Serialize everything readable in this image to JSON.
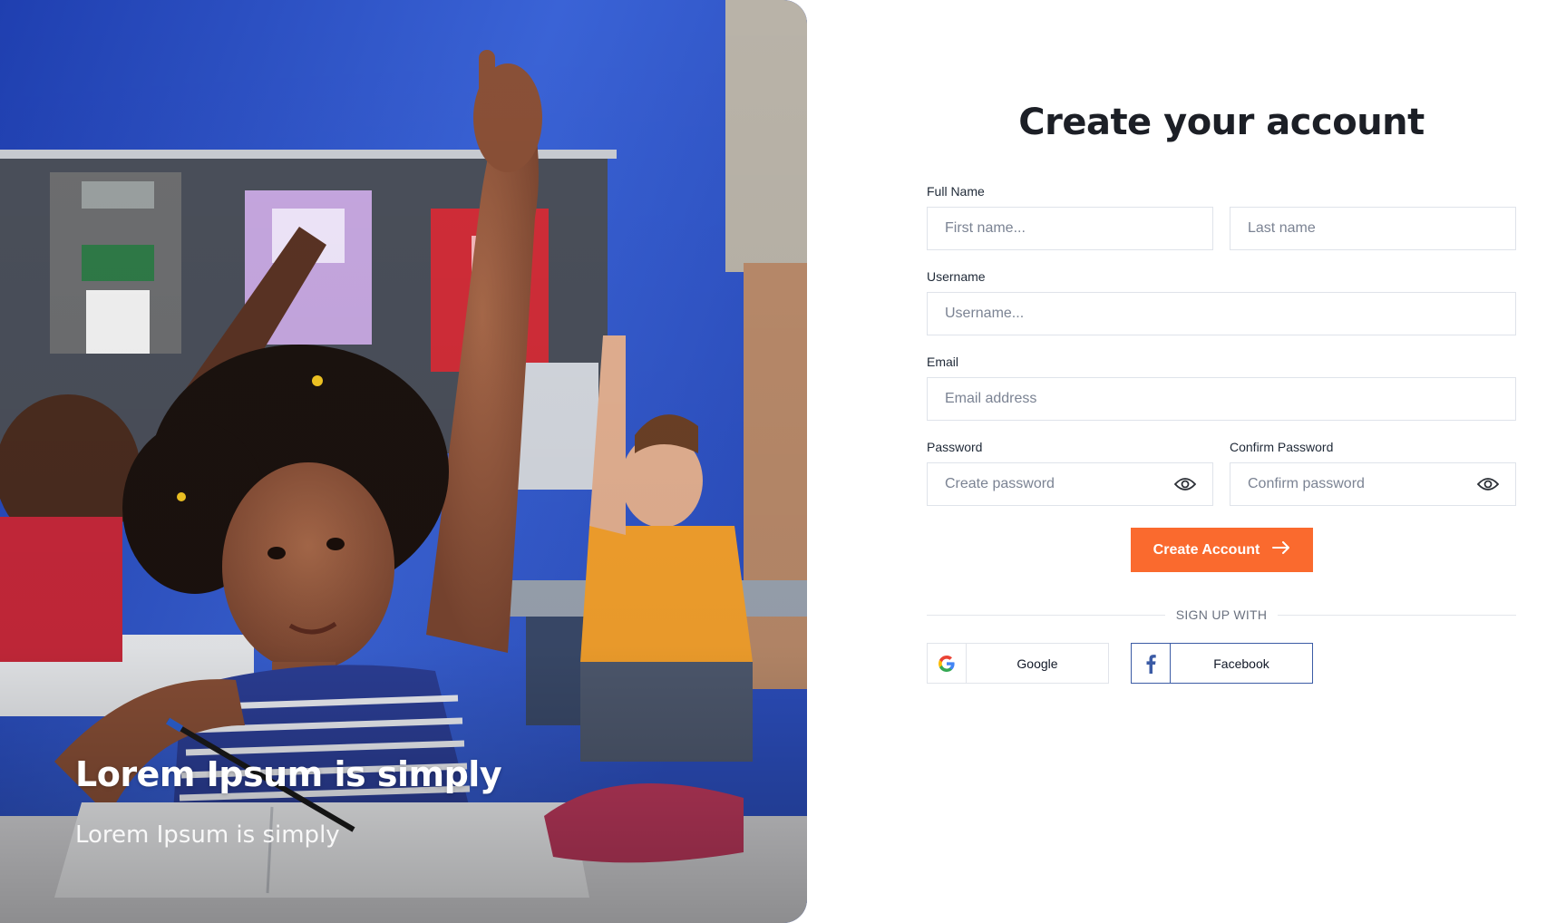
{
  "hero": {
    "title": "Lorem Ipsum is simply",
    "subtitle": "Lorem Ipsum is simply"
  },
  "form": {
    "title": "Create your account",
    "full_name": {
      "label": "Full Name",
      "first_placeholder": "First name...",
      "last_placeholder": "Last name"
    },
    "username": {
      "label": "Username",
      "placeholder": "Username..."
    },
    "email": {
      "label": "Email",
      "placeholder": "Email address"
    },
    "password": {
      "label": "Password",
      "placeholder": "Create password"
    },
    "confirm_password": {
      "label": "Confirm Password",
      "placeholder": "Confirm password"
    },
    "submit_label": "Create Account",
    "divider_text": "SIGN UP WITH",
    "social": {
      "google_label": "Google",
      "facebook_label": "Facebook"
    }
  },
  "colors": {
    "accent": "#fa6a2e",
    "facebook": "#3b5ba5",
    "border": "#dfe3ea",
    "placeholder": "#7b8393"
  },
  "icons": {
    "eye": "eye-icon",
    "arrow": "arrow-right-icon",
    "google": "google-icon",
    "facebook": "facebook-icon"
  }
}
